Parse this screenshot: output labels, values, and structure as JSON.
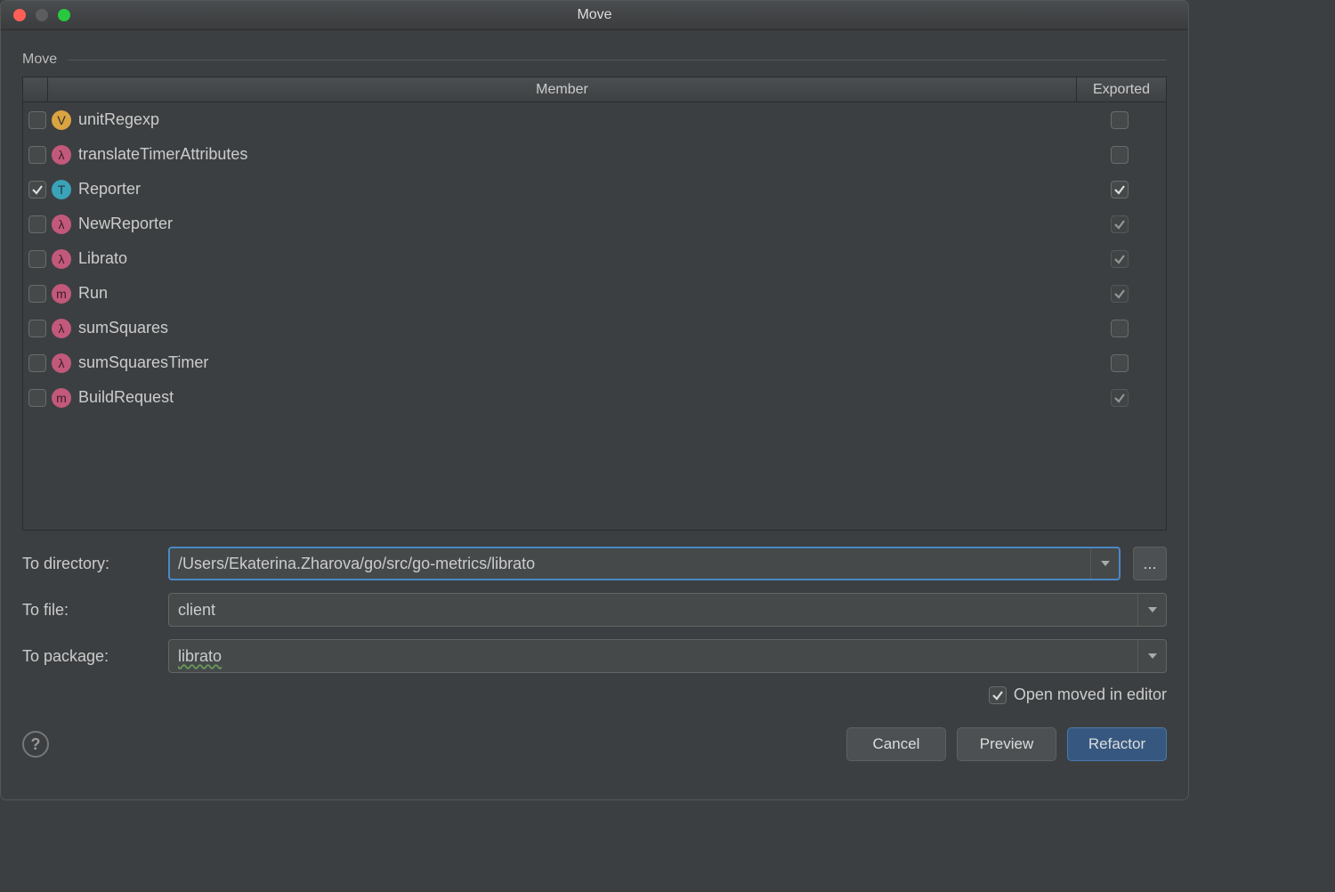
{
  "window": {
    "title": "Move"
  },
  "section": {
    "title": "Move"
  },
  "columns": {
    "member": "Member",
    "exported": "Exported"
  },
  "members": [
    {
      "icon": "v",
      "label": "unitRegexp",
      "selected": false,
      "exported": false,
      "exportedDisabled": false
    },
    {
      "icon": "lambda",
      "label": "translateTimerAttributes",
      "selected": false,
      "exported": false,
      "exportedDisabled": false
    },
    {
      "icon": "t",
      "label": "Reporter",
      "selected": true,
      "exported": true,
      "exportedDisabled": false
    },
    {
      "icon": "lambda",
      "label": "NewReporter",
      "selected": false,
      "exported": true,
      "exportedDisabled": true
    },
    {
      "icon": "lambda",
      "label": "Librato",
      "selected": false,
      "exported": true,
      "exportedDisabled": true
    },
    {
      "icon": "m",
      "label": "Run",
      "selected": false,
      "exported": true,
      "exportedDisabled": true
    },
    {
      "icon": "lambda",
      "label": "sumSquares",
      "selected": false,
      "exported": false,
      "exportedDisabled": false
    },
    {
      "icon": "lambda",
      "label": "sumSquaresTimer",
      "selected": false,
      "exported": false,
      "exportedDisabled": false
    },
    {
      "icon": "m",
      "label": "BuildRequest",
      "selected": false,
      "exported": true,
      "exportedDisabled": true
    }
  ],
  "form": {
    "toDirectoryLabel": "To directory:",
    "toDirectoryValue": "/Users/Ekaterina.Zharova/go/src/go-metrics/librato",
    "toFileLabel": "To file:",
    "toFileValue": "client",
    "toPackageLabel": "To package:",
    "toPackageValue": "librato",
    "openInEditorLabel": "Open moved in editor",
    "openInEditorChecked": true
  },
  "buttons": {
    "cancel": "Cancel",
    "preview": "Preview",
    "refactor": "Refactor",
    "browse": "..."
  },
  "iconGlyphs": {
    "v": "V",
    "lambda": "λ",
    "t": "T",
    "m": "m"
  }
}
